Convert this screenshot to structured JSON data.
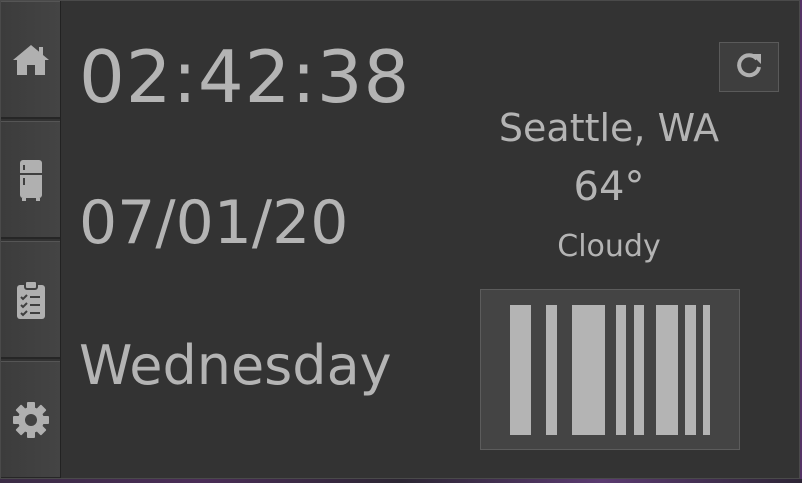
{
  "clock": {
    "time": "02:42:38"
  },
  "date": {
    "value": "07/01/20"
  },
  "day": {
    "name": "Wednesday"
  },
  "weather": {
    "city": "Seattle, WA",
    "temperature": "64°",
    "condition": "Cloudy",
    "icon": "fog-bars-icon"
  },
  "sidebar": {
    "items": [
      {
        "icon": "home-icon"
      },
      {
        "icon": "fridge-icon"
      },
      {
        "icon": "clipboard-checklist-icon"
      },
      {
        "icon": "gear-icon"
      }
    ]
  },
  "colors": {
    "background": "#333333",
    "text": "#b4b4b4",
    "sidebar": "#404040",
    "icon": "#b0b0b0"
  }
}
